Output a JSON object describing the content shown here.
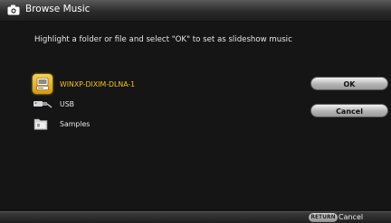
{
  "window": {
    "title": "Browse Music",
    "title_icon": "camera-icon"
  },
  "instruction": "Highlight a folder or file and select \"OK\" to set as slideshow music",
  "items": [
    {
      "label": "WINXP-DIXIM-DLNA-1",
      "icon": "media-server-icon",
      "selected": true
    },
    {
      "label": "USB",
      "icon": "usb-icon",
      "selected": false
    },
    {
      "label": "Samples",
      "icon": "folder-icon",
      "selected": false
    }
  ],
  "buttons": {
    "ok_label": "OK",
    "cancel_label": "Cancel"
  },
  "footer": {
    "key_label": "RETURN",
    "action_label": "Cancel"
  },
  "colors": {
    "selected_text": "#f5c21a",
    "selected_icon_bg": "#e2ac1a",
    "background": "#151515"
  }
}
